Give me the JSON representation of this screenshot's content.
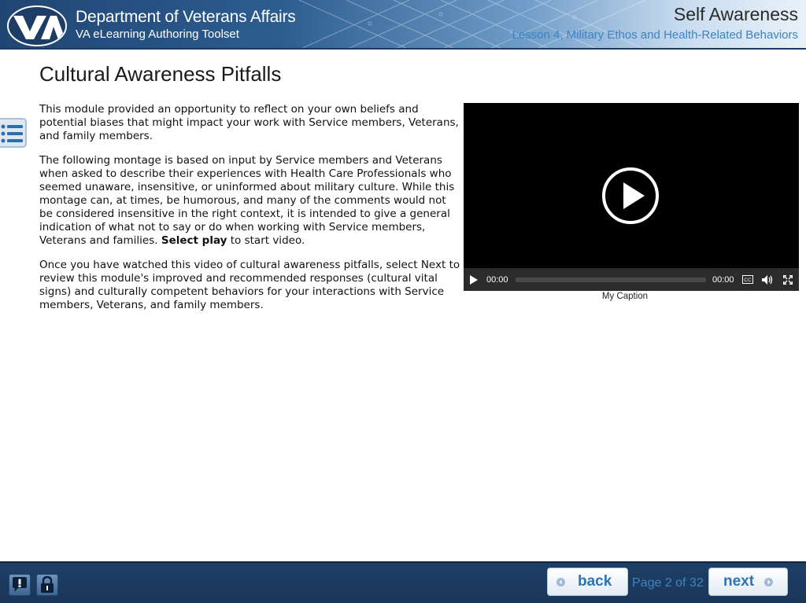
{
  "header": {
    "organization": "Department of Veterans Affairs",
    "toolset": "VA eLearning Authoring Toolset",
    "course_title": "Self Awareness",
    "lesson_title": "Lesson 4, Military Ethos and Health-Related Behaviors",
    "logo_icon": "va-seal-logo"
  },
  "sidebar": {
    "menu_icon": "list-menu-icon"
  },
  "page": {
    "title": "Cultural Awareness Pitfalls",
    "paragraph_1": "This module provided an opportunity to reflect on your own beliefs and potential biases that might impact your work with Service members, Veterans, and family members.",
    "paragraph_2_intro": "The following montage is based on input by Service members and Veterans when asked to describe their experiences with Health Care Professionals who seemed unaware, insensitive, or uninformed about military culture. While this montage can, at times, be humorous, and many of the comments would not be considered insensitive in the right context, it is intended to give a general indication of what not to say or do when working with Service members, Veterans and families.",
    "paragraph_2_bold": "Select play",
    "paragraph_2_end": " to start video.",
    "paragraph_3": "Once you have watched this video of cultural awareness pitfalls, select Next to review this module's improved and recommended responses (cultural vital signs) and culturally competent behaviors for your interactions with Service members, Veterans, and family members."
  },
  "video": {
    "current_time": "00:00",
    "duration": "00:00",
    "progress": 0,
    "caption": "My Caption",
    "icons": [
      "play-icon",
      "closed-captions-icon",
      "volume-icon",
      "fullscreen-icon"
    ]
  },
  "footer": {
    "help_icon": "help-icon",
    "lock_icon": "lock-icon",
    "back_label": "back",
    "next_label": "next",
    "page_indicator": "Page 2 of 32",
    "colors": {
      "bar": "#1f3f66",
      "accent": "#2e74b5"
    }
  }
}
